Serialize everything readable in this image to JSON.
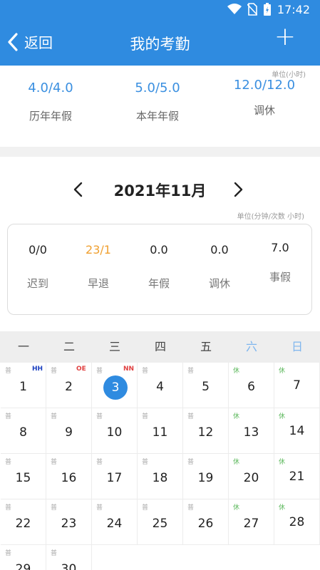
{
  "status_bar": {
    "time": "17:42"
  },
  "app_bar": {
    "back_label": "返回",
    "title": "我的考勤",
    "add_label": "+"
  },
  "leave_summary": {
    "unit": "单位(小时)",
    "items": [
      {
        "value": "4.0/4.0",
        "label": "历年年假"
      },
      {
        "value": "5.0/5.0",
        "label": "本年年假"
      },
      {
        "value": "12.0/12.0",
        "label": "调休"
      }
    ]
  },
  "month_nav": {
    "label": "2021年11月"
  },
  "stats": {
    "unit": "单位(分钟/次数 小时)",
    "items": [
      {
        "value": "0/0",
        "label": "迟到"
      },
      {
        "value": "23/1",
        "label": "早退"
      },
      {
        "value": "0.0",
        "label": "年假"
      },
      {
        "value": "0.0",
        "label": "调休"
      },
      {
        "value": "7.0",
        "label": "事假"
      }
    ]
  },
  "weekdays": [
    "一",
    "二",
    "三",
    "四",
    "五",
    "六",
    "日"
  ],
  "calendar": {
    "days": [
      {
        "day": "1",
        "tag": "普",
        "mark": "HH",
        "mark_color": "#1a3fc0"
      },
      {
        "day": "2",
        "tag": "普",
        "mark": "OE",
        "mark_color": "#e04040"
      },
      {
        "day": "3",
        "tag": "普",
        "mark": "NN",
        "mark_color": "#e04040",
        "today": true
      },
      {
        "day": "4",
        "tag": "普"
      },
      {
        "day": "5",
        "tag": "普"
      },
      {
        "day": "6",
        "tag": "休"
      },
      {
        "day": "7",
        "tag": "休"
      },
      {
        "day": "8",
        "tag": "普"
      },
      {
        "day": "9",
        "tag": "普"
      },
      {
        "day": "10",
        "tag": "普"
      },
      {
        "day": "11",
        "tag": "普"
      },
      {
        "day": "12",
        "tag": "普"
      },
      {
        "day": "13",
        "tag": "休"
      },
      {
        "day": "14",
        "tag": "休"
      },
      {
        "day": "15",
        "tag": "普"
      },
      {
        "day": "16",
        "tag": "普"
      },
      {
        "day": "17",
        "tag": "普"
      },
      {
        "day": "18",
        "tag": "普"
      },
      {
        "day": "19",
        "tag": "普"
      },
      {
        "day": "20",
        "tag": "休"
      },
      {
        "day": "21",
        "tag": "休"
      },
      {
        "day": "22",
        "tag": "普"
      },
      {
        "day": "23",
        "tag": "普"
      },
      {
        "day": "24",
        "tag": "普"
      },
      {
        "day": "25",
        "tag": "普"
      },
      {
        "day": "26",
        "tag": "普"
      },
      {
        "day": "27",
        "tag": "休"
      },
      {
        "day": "28",
        "tag": "休"
      },
      {
        "day": "29",
        "tag": "普"
      },
      {
        "day": "30",
        "tag": "普"
      }
    ]
  },
  "colors": {
    "primary": "#2f8be0",
    "accent_orange": "#f0a030",
    "rest_green": "#5cb85c",
    "weekend_blue": "#7fb6ee"
  }
}
